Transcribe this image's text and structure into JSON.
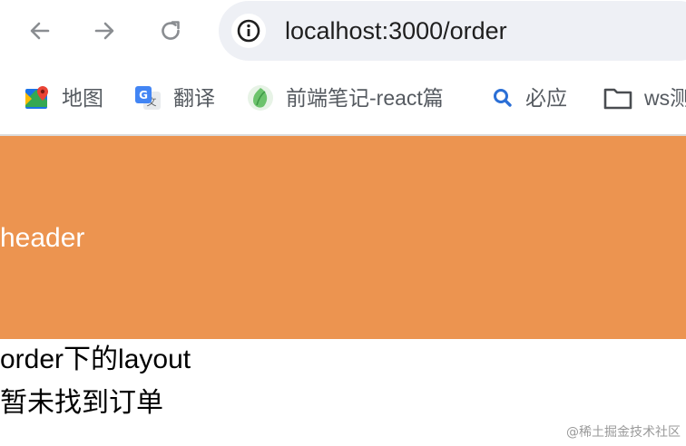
{
  "browser": {
    "url": "localhost:3000/order"
  },
  "bookmarks": [
    {
      "label": "地图",
      "icon": "maps-icon"
    },
    {
      "label": "翻译",
      "icon": "translate-icon"
    },
    {
      "label": "前端笔记-react篇",
      "icon": "notes-icon"
    },
    {
      "label": "必应",
      "icon": "search-icon"
    },
    {
      "label": "ws测",
      "icon": "folder-icon"
    }
  ],
  "page": {
    "header_text": "header",
    "layout_text": "order下的layout",
    "empty_text": "暂未找到订单"
  },
  "watermark": "@稀土掘金技术社区",
  "colors": {
    "header_bg": "#ec9450",
    "omnibox_bg": "#eef0f5"
  }
}
